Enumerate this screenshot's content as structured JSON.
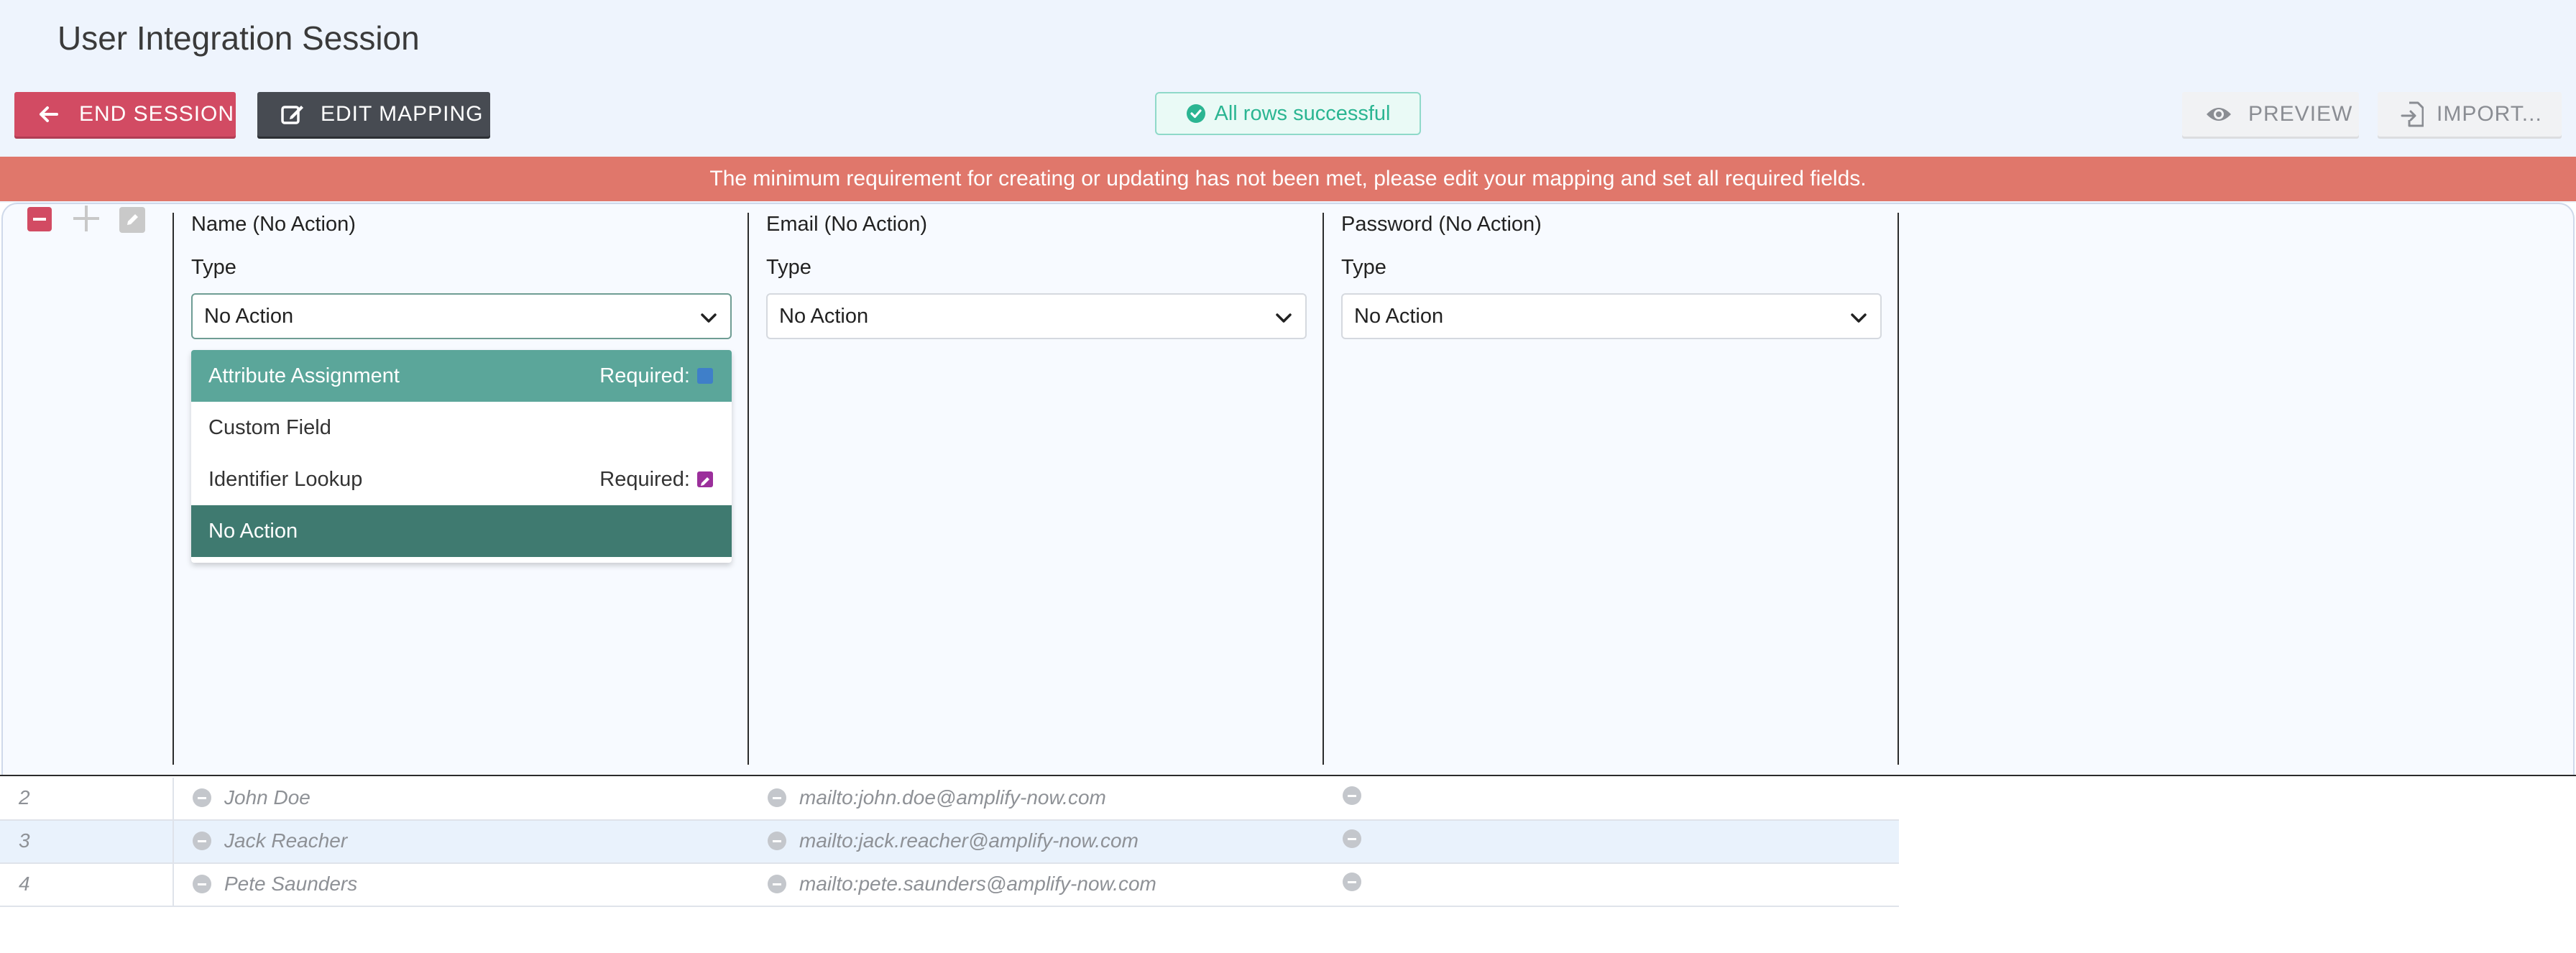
{
  "header": {
    "title": "User Integration Session"
  },
  "toolbar": {
    "end_session": "END SESSION",
    "edit_mapping": "EDIT MAPPING",
    "status": "All rows successful",
    "preview": "PREVIEW",
    "import": "IMPORT..."
  },
  "alert": {
    "message": "The minimum requirement for creating or updating has not been met, please edit your mapping and set all required fields."
  },
  "columns": [
    {
      "header": "Name (No Action)",
      "type_label": "Type",
      "selected": "No Action"
    },
    {
      "header": "Email (No Action)",
      "type_label": "Type",
      "selected": "No Action"
    },
    {
      "header": "Password (No Action)",
      "type_label": "Type",
      "selected": "No Action"
    }
  ],
  "dropdown": {
    "options": [
      {
        "label": "Attribute Assignment",
        "required": "Required:"
      },
      {
        "label": "Custom Field"
      },
      {
        "label": "Identifier Lookup",
        "required": "Required:"
      },
      {
        "label": "No Action"
      }
    ]
  },
  "rows": [
    {
      "num": "2",
      "name": "John Doe",
      "email": "mailto:john.doe@amplify-now.com"
    },
    {
      "num": "3",
      "name": "Jack Reacher",
      "email": "mailto:jack.reacher@amplify-now.com"
    },
    {
      "num": "4",
      "name": "Pete Saunders",
      "email": "mailto:pete.saunders@amplify-now.com"
    }
  ],
  "colors": {
    "danger": "#d24b63",
    "dark": "#474b52",
    "success": "#2bb592",
    "alert": "#e0776b",
    "option_highlight": "#5ba69a",
    "option_selected": "#3f7a70",
    "required_attribute": "#3f7fc9",
    "required_identifier": "#9b2f9b"
  },
  "icons": {
    "end_session": "arrow-left-icon",
    "edit_mapping": "edit-icon",
    "status": "check-circle-icon",
    "preview": "eye-icon",
    "import": "import-icon"
  }
}
